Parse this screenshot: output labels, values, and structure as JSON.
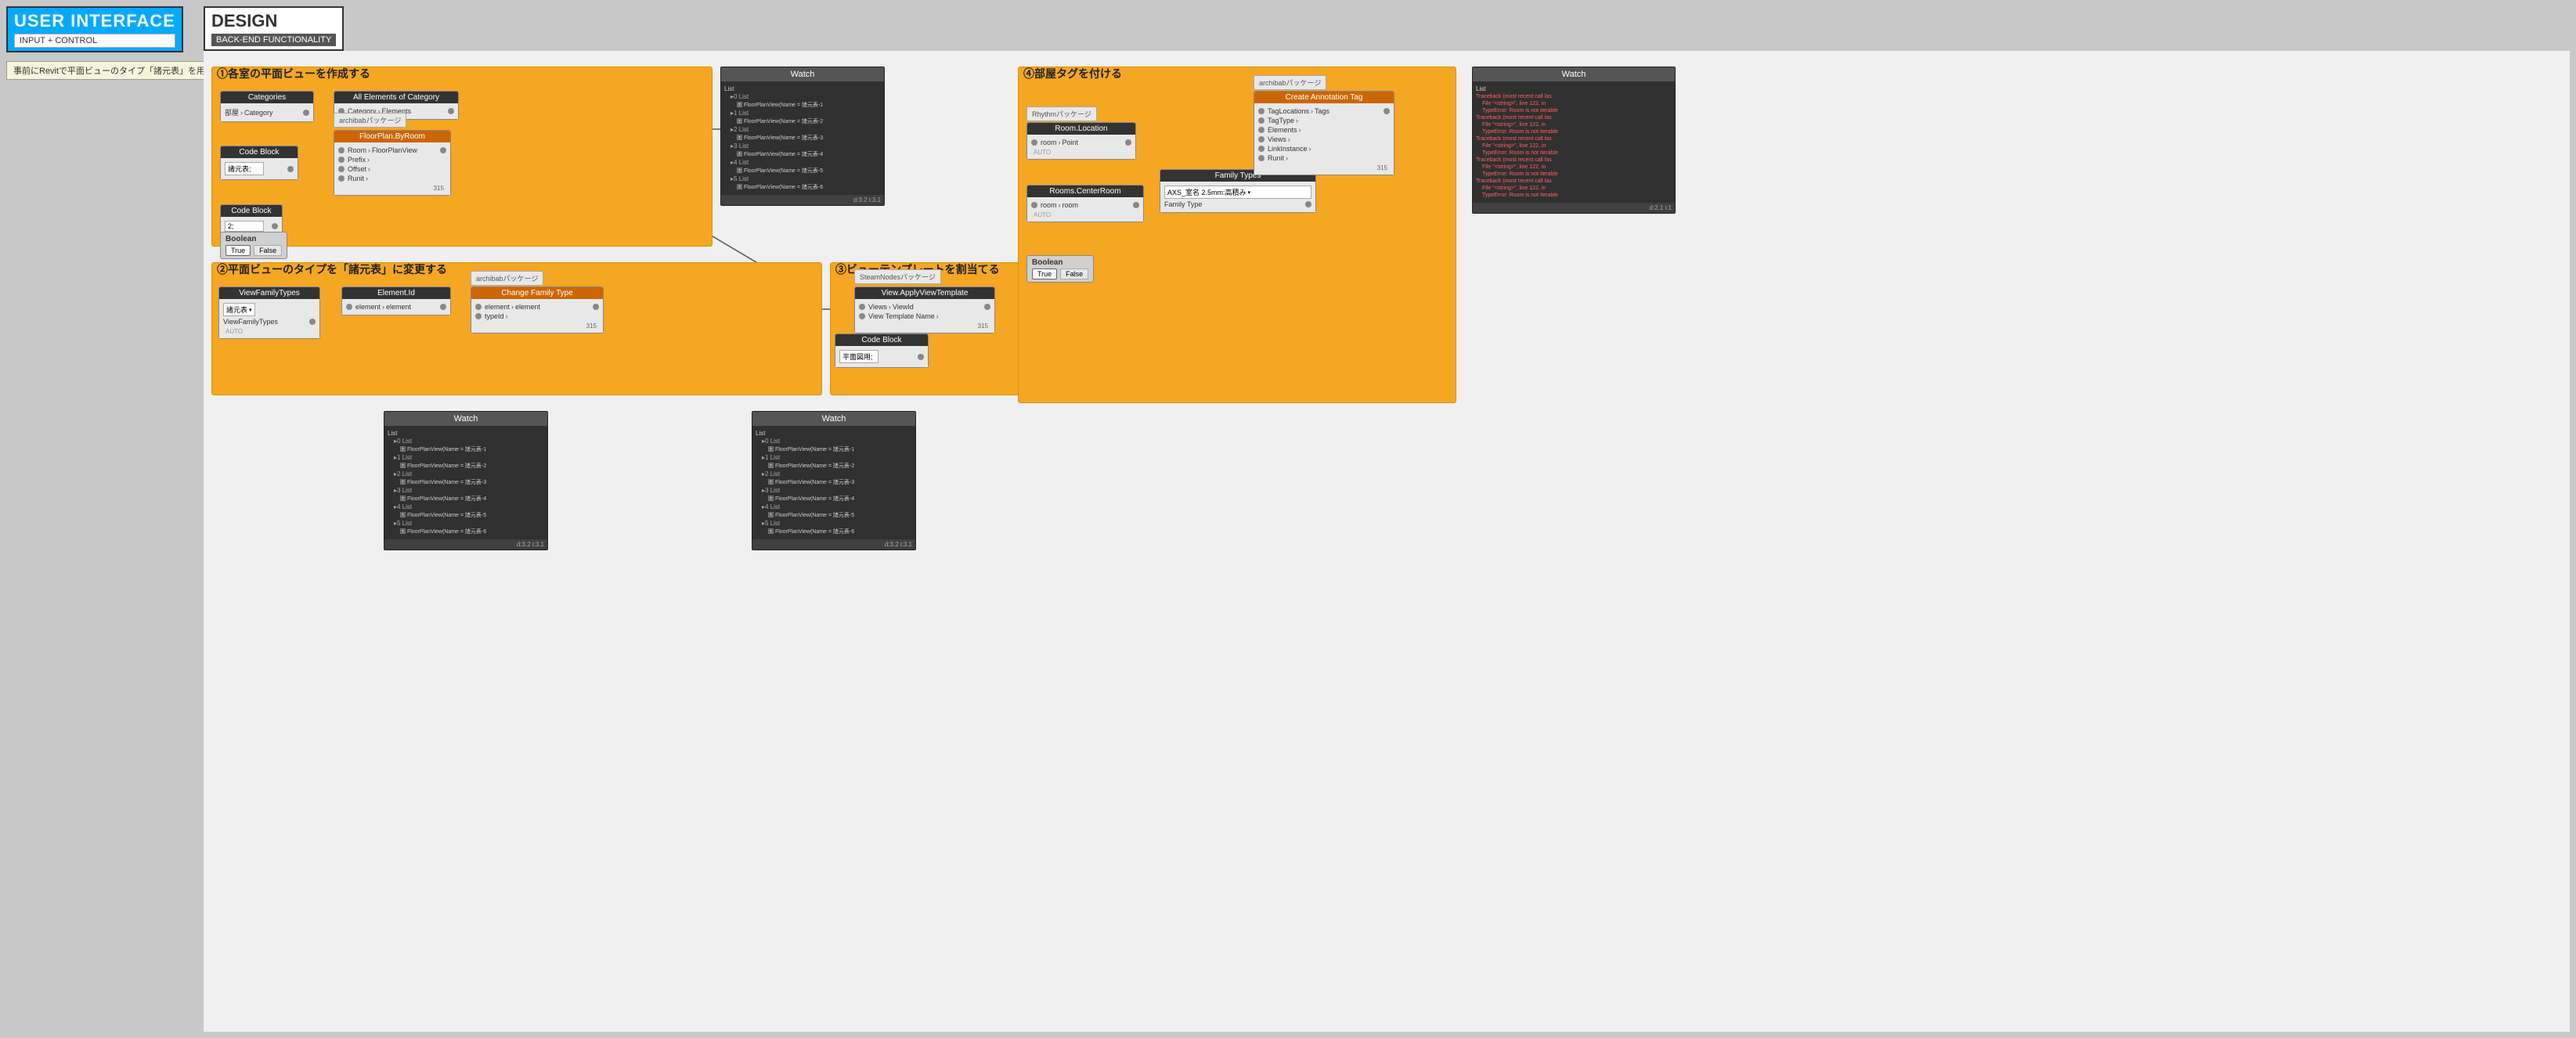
{
  "ui_panel": {
    "title": "USER INTERFACE",
    "subtitle": "INPUT + CONTROL"
  },
  "design_panel": {
    "title": "DESIGN",
    "subtitle": "BACK-END FUNCTIONALITY"
  },
  "note": "事前にRevitで平面ビューのタイプ「諸元表」を用意すること",
  "section1": {
    "label": "①各室の平面ビューを作成する",
    "categories_node": {
      "header": "Categories",
      "port": "Category",
      "value": "部屋"
    },
    "all_elements_node": {
      "header": "All Elements of Category",
      "port_in": "Category",
      "port_out": "Elements"
    },
    "codeblock1_node": {
      "header": "Code Block",
      "value": "諸元表;"
    },
    "floorplan_node": {
      "header": "FloorPlan.ByRoom",
      "ports": [
        "Room",
        "Prefix",
        "Offset",
        "Runit"
      ],
      "port_out": "FloorPlanView"
    },
    "codeblock2_node": {
      "header": "Code Block",
      "value": "2;"
    },
    "boolean_node": {
      "header": "Boolean",
      "true_label": "True",
      "false_label": "False"
    },
    "pkg_label": "archibabパッケージ"
  },
  "section2": {
    "label": "②平面ビューのタイプを「諸元表」に変更する",
    "viewfamilytypes_node": {
      "header": "ViewFamilyTypes",
      "value": "諸元表",
      "port": "ViewFamilyTypes"
    },
    "elementid_node": {
      "header": "Element.Id",
      "port_in": "element",
      "port_out": "element"
    },
    "changefamilytype_node": {
      "header": "Change Family Type",
      "port_in1": "element",
      "port_in2": "typeId",
      "port_out": "element"
    },
    "pkg_label": "archibabパッケージ"
  },
  "section3": {
    "label": "③ビューテンプレートを割当てる",
    "steamnodes_pkg": "SteamNodesパッケージ",
    "viewapplytemplate_node": {
      "header": "View.ApplyViewTemplate",
      "port_in1": "Views",
      "port_in2": "View Template Name",
      "port_out": "ViewId"
    },
    "codeblock_node": {
      "header": "Code Block",
      "value": "平面図用;"
    }
  },
  "section4": {
    "label": "④部屋タグを付ける",
    "rhythm_pkg": "Rhythmパッケージ",
    "archilab_pkg": "archibabパッケージ",
    "roomlocation_node": {
      "header": "Room.Location",
      "port_in": "room",
      "port_out": "Point"
    },
    "roomscenterroom_node": {
      "header": "Rooms.CenterRoom",
      "port_in": "room",
      "port_out": "room"
    },
    "familytypes_node": {
      "header": "Family Types",
      "value": "AXS_室名 2.5mm:高積み",
      "port": "Family Type"
    },
    "createannotationtag_node": {
      "header": "Create Annotation Tag",
      "port_in1": "TagLocations",
      "port_in2": "TagType",
      "port_in3": "Elements",
      "port_in4": "Views",
      "port_in5": "LinkInstance",
      "port_in6": "Runit",
      "port_out": "Tags"
    },
    "boolean_node": {
      "header": "Boolean",
      "true_label": "True",
      "false_label": "False"
    }
  },
  "watch1": {
    "header": "Watch",
    "lines": [
      "List",
      " 0 List",
      "  圖 FloorPlanView(Name = 諸元表-1",
      " 1 List",
      "  圖 FloorPlanView(Name = 諸元表-2",
      " 2 List",
      "  圖 FloorPlanView(Name = 諸元表-3",
      " 3 List",
      "  圖 FloorPlanView(Name = 諸元表-4",
      " 4 List",
      "  圖 FloorPlanView(Name = 諸元表-5",
      " 5 List",
      "  圖 FloorPlanView(Name = 諸元表-6"
    ],
    "footer": "d:3.2 i:3.1"
  },
  "watch2": {
    "header": "Watch",
    "lines": [
      "List",
      " 0 List",
      "  圖 FloorPlanView(Name = 諸元表-1",
      " 1 List",
      "  圖 FloorPlanView(Name = 諸元表-2",
      " 2 List",
      "  圖 FloorPlanView(Name = 諸元表-3",
      " 3 List",
      "  圖 FloorPlanView(Name = 諸元表-4",
      " 4 List",
      "  圖 FloorPlanView(Name = 諸元表-5",
      " 5 List",
      "  圖 FloorPlanView(Name = 諸元表-6"
    ],
    "footer": "d:3.2 i:3.1"
  },
  "watch3": {
    "header": "Watch",
    "lines": [
      "List",
      " 0 List",
      "  圖 FloorPlanView(Name = 諸元表-1",
      " 1 List",
      "  圖 FloorPlanView(Name = 諸元表-2",
      " 2 List",
      "  圖 FloorPlanView(Name = 諸元表-3",
      " 3 List",
      "  圖 FloorPlanView(Name = 諸元表-4",
      " 4 List",
      "  圖 FloorPlanView(Name = 諸元表-5",
      " 5 List",
      "  圖 FloorPlanView(Name = 諸元表-6"
    ],
    "footer": "d:3.2 i:3.1"
  },
  "watch_error": {
    "header": "Watch",
    "lines": [
      "List",
      "Traceback (most recent call last):",
      "  File \"<string>\", line 122, in",
      "  TypeError: Room is not iterable",
      "Traceback (most recent call last):",
      "  File \"<string>\", line 122, in",
      "  TypeError: Room is not iterable",
      "Traceback (most recent call last):",
      "  File \"<string>\", line 122, in",
      "  TypeError: Room is not iterable",
      "Traceback (most recent call last):",
      "  File \"<string>\", line 122, in",
      "  TypeError: Room is not iterable",
      "Traceback (most recent call last):",
      "  File \"<string>\", line 122, in",
      "  TypeError: Room is not iterable"
    ],
    "footer": "d:2.1 i:1"
  }
}
